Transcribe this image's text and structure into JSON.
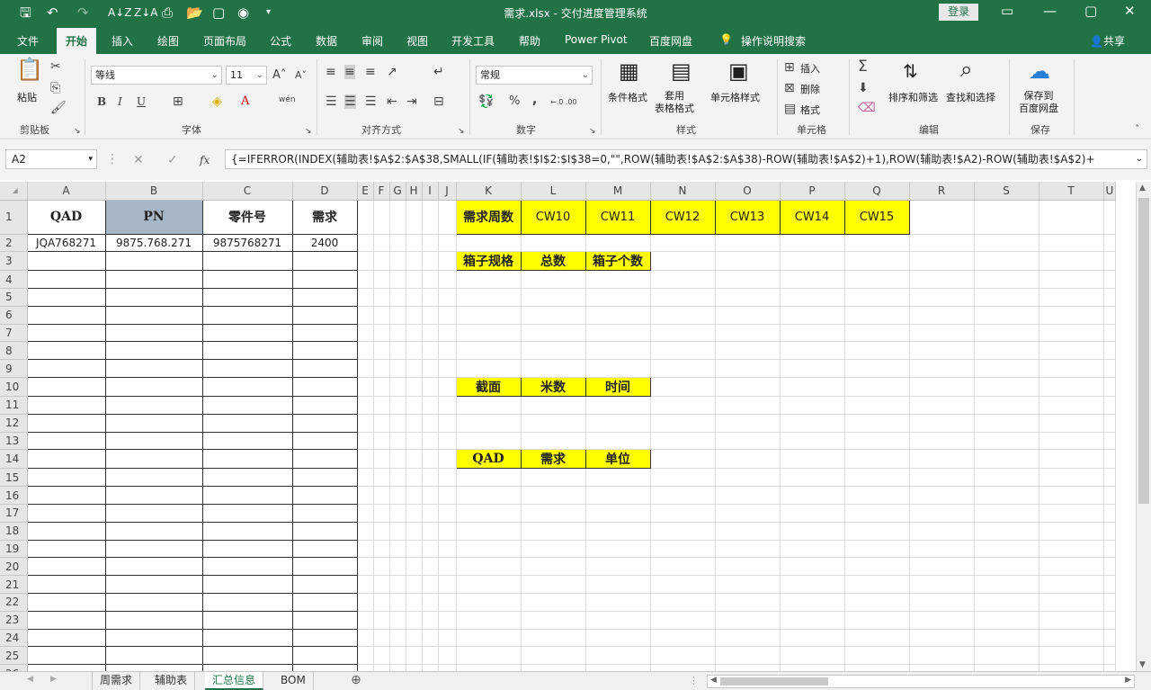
{
  "titlebar": {
    "title": "需求.xlsx  -  交付进度管理系统",
    "login": "登录",
    "icons": [
      "save-icon",
      "undo-icon",
      "redo-icon",
      "sort-asc-icon",
      "sort-desc-icon",
      "print-preview-icon",
      "open-icon",
      "new-icon",
      "camera-icon",
      "customize-icon"
    ]
  },
  "ribbon_tabs": [
    "文件",
    "开始",
    "插入",
    "绘图",
    "页面布局",
    "公式",
    "数据",
    "审阅",
    "视图",
    "开发工具",
    "帮助",
    "Power Pivot",
    "百度网盘",
    "操作说明搜索"
  ],
  "share": "共享",
  "ribbon": {
    "clipboard": {
      "paste": "粘贴",
      "label": "剪贴板"
    },
    "font": {
      "name": "等线",
      "size": "11",
      "label": "字体",
      "bold": "B",
      "italic": "I",
      "underline": "U",
      "grow": "A",
      "shrink": "A",
      "wen": "wén"
    },
    "align": {
      "label": "对齐方式"
    },
    "number": {
      "format": "常规",
      "label": "数字",
      "percent": "%",
      "comma": ",",
      "inc_dec": "←.0 .00",
      "dec_dec": ".00 →.0"
    },
    "styles": {
      "cond": "条件格式",
      "table": "套用\n表格格式",
      "cell": "单元格样式",
      "label": "样式"
    },
    "cells": {
      "insert": "插入",
      "delete": "删除",
      "format": "格式",
      "label": "单元格"
    },
    "editing": {
      "sort": "排序和筛选",
      "find": "查找和选择",
      "label": "编辑"
    },
    "save": {
      "btn": "保存到\n百度网盘",
      "label": "保存"
    }
  },
  "formula_bar": {
    "name_box": "A2",
    "formula": "{=IFERROR(INDEX(辅助表!$A$2:$A$38,SMALL(IF(辅助表!$I$2:$I$38=0,\"\",ROW(辅助表!$A$2:$A$38)-ROW(辅助表!$A$2)+1),ROW(辅助表!$A2)-ROW(辅助表!$A$2)+"
  },
  "columns": [
    "A",
    "B",
    "C",
    "D",
    "E",
    "F",
    "G",
    "H",
    "I",
    "J",
    "K",
    "L",
    "M",
    "N",
    "O",
    "P",
    "Q",
    "R",
    "S",
    "T",
    "U"
  ],
  "rows": [
    "1",
    "2",
    "3",
    "4",
    "5",
    "6",
    "7",
    "8",
    "9",
    "10",
    "11",
    "12",
    "13",
    "14",
    "15",
    "16",
    "17",
    "18",
    "19",
    "20",
    "21",
    "22",
    "23",
    "24",
    "25",
    "26"
  ],
  "table_headers": [
    "QAD",
    "PN",
    "零件号",
    "需求"
  ],
  "table_row": [
    "JQA768271",
    "9875.768.271",
    "9875768271",
    "2400"
  ],
  "week_header": [
    "需求周数",
    "CW10",
    "CW11",
    "CW12",
    "CW13",
    "CW14",
    "CW15"
  ],
  "box_header": [
    "箱子规格",
    "总数",
    "箱子个数"
  ],
  "section_header": [
    "截面",
    "米数",
    "时间"
  ],
  "qad_header": [
    "QAD",
    "需求",
    "单位"
  ],
  "sheet_tabs": [
    "周需求",
    "辅助表",
    "汇总信息",
    "BOM"
  ],
  "active_sheet": "汇总信息",
  "colors": {
    "green": "#217346",
    "yellow": "#ffff00",
    "pn_fill": "#a7b6c5"
  }
}
